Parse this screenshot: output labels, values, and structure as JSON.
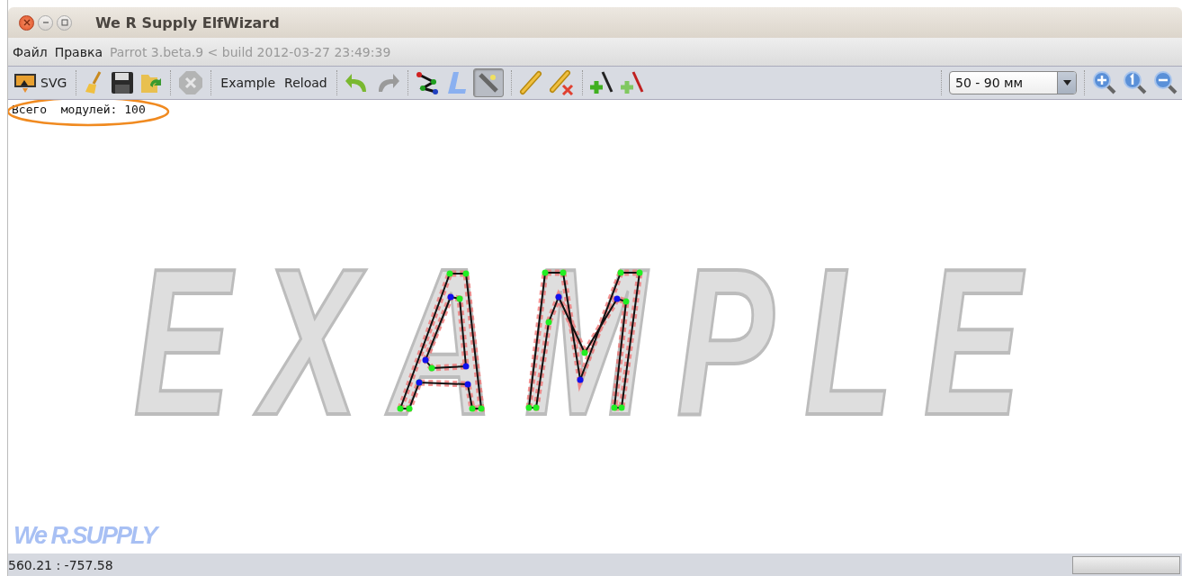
{
  "window": {
    "title": "We R Supply ElfWizard"
  },
  "menu": {
    "items": [
      "Файл",
      "Правка"
    ],
    "version": "Parrot 3.beta.9 < build 2012-03-27 23:49:39"
  },
  "toolbar": {
    "svg_button": "SVG",
    "stop_disabled": true,
    "example_button": "Example",
    "reload_button": "Reload",
    "redo_disabled": true,
    "wand_pressed": true,
    "scale_select": "50 - 90 мм"
  },
  "canvas": {
    "module_count": "Всего  модулей: 100",
    "watermark_text": "EXAMPLE",
    "logo": "We R.SUPPLY"
  },
  "status_bar": {
    "coordinates": "560.21 : -757.58"
  }
}
